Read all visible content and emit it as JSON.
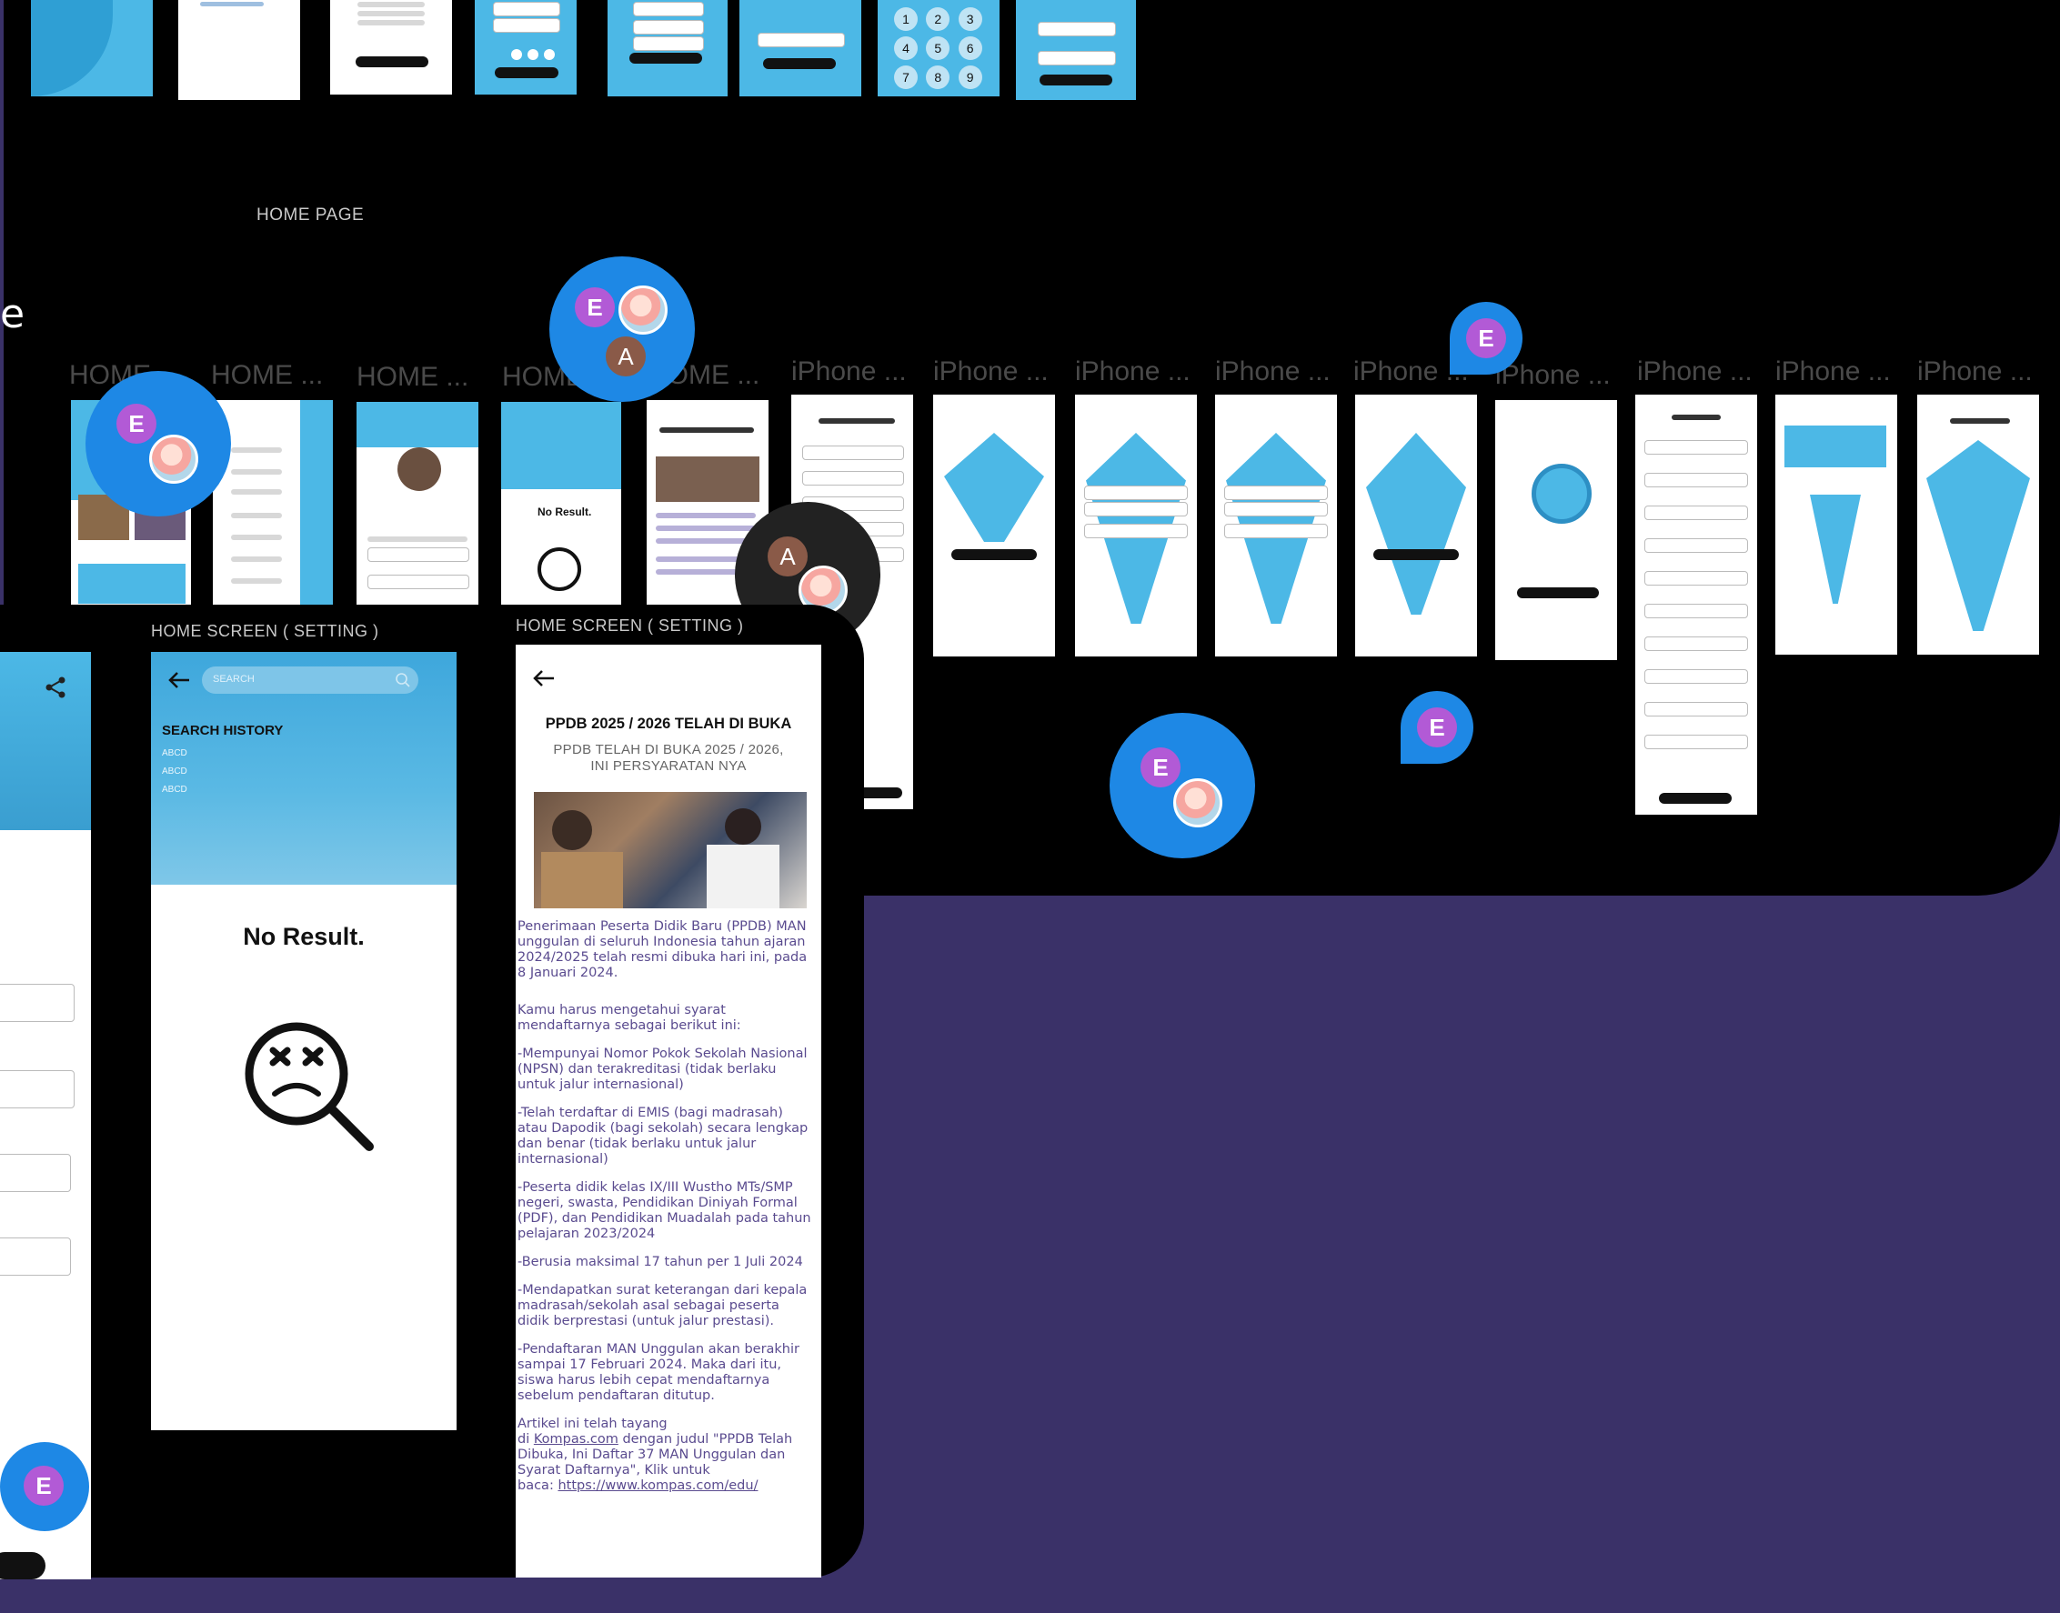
{
  "labels": {
    "home_page": "HOME PAGE",
    "left_cut_letter": "e",
    "settings_label_1": "HOME SCREEN ( SETTING )",
    "settings_label_2": "HOME SCREEN ( SETTING )"
  },
  "frames": [
    {
      "label": "HOME ..."
    },
    {
      "label": "HOME ..."
    },
    {
      "label": "HOME ..."
    },
    {
      "label": "HOME ..."
    },
    {
      "label": "HOME ..."
    },
    {
      "label": "iPhone ..."
    },
    {
      "label": "iPhone ..."
    },
    {
      "label": "iPhone ..."
    },
    {
      "label": "iPhone ..."
    },
    {
      "label": "iPhone ..."
    },
    {
      "label": "iPhone ..."
    },
    {
      "label": "iPhone ..."
    },
    {
      "label": "iPhone ..."
    },
    {
      "label": "iPhone ..."
    }
  ],
  "avatars": {
    "e": "E",
    "a": "A"
  },
  "search_screen": {
    "placeholder": "SEARCH",
    "history_title": "SEARCH HISTORY",
    "history_items": [
      "ABCD",
      "ABCD",
      "ABCD"
    ],
    "no_result": "No Result."
  },
  "article": {
    "title": "PPDB 2025 / 2026 TELAH DI BUKA",
    "subtitle_1": "PPDB TELAH DI BUKA 2025 / 2026,",
    "subtitle_2": "INI PERSYARATAN NYA",
    "paragraphs": [
      "Penerimaan Peserta Didik Baru (PPDB) MAN unggulan di seluruh Indonesia tahun ajaran 2024/2025 telah resmi dibuka hari ini, pada 8 Januari 2024.",
      "Kamu harus mengetahui syarat mendaftarnya sebagai berikut ini:",
      "-Mempunyai Nomor Pokok Sekolah Nasional (NPSN) dan terakreditasi (tidak berlaku untuk jalur internasional)",
      "-Telah terdaftar di EMIS (bagi madrasah) atau Dapodik (bagi sekolah) secara lengkap dan benar (tidak berlaku untuk jalur internasional)",
      "-Peserta didik kelas IX/III Wustho MTs/SMP negeri, swasta, Pendidikan Diniyah Formal (PDF), dan Pendidikan Muadalah pada tahun pelajaran 2023/2024",
      "-Berusia maksimal 17 tahun per 1 Juli 2024",
      "-Mendapatkan surat keterangan dari kepala madrasah/sekolah asal sebagai peserta didik berprestasi (untuk jalur prestasi).",
      "-Pendaftaran MAN Unggulan akan berakhir sampai 17 Februari 2024. Maka dari itu, siswa harus lebih cepat mendaftarnya sebelum pendaftaran ditutup."
    ],
    "footer_1": "Artikel ini telah tayang",
    "footer_2a": "di ",
    "footer_link": "Kompas.com",
    "footer_2b": " dengan judul \"PPDB Telah Dibuka, Ini Daftar 37 MAN Unggulan dan Syarat Daftarnya\", Klik untuk",
    "footer_3a": "baca: ",
    "footer_url": "https://www.kompas.com/edu/"
  },
  "keypad": [
    "1",
    "2",
    "3",
    "4",
    "5",
    "6",
    "7",
    "8",
    "9"
  ],
  "colors": {
    "canvas": "#000000",
    "background": "#3a3168",
    "screen_blue": "#4cb8e6",
    "avatar_blue": "#1e88e5",
    "avatar_e": "#b25ad6"
  }
}
